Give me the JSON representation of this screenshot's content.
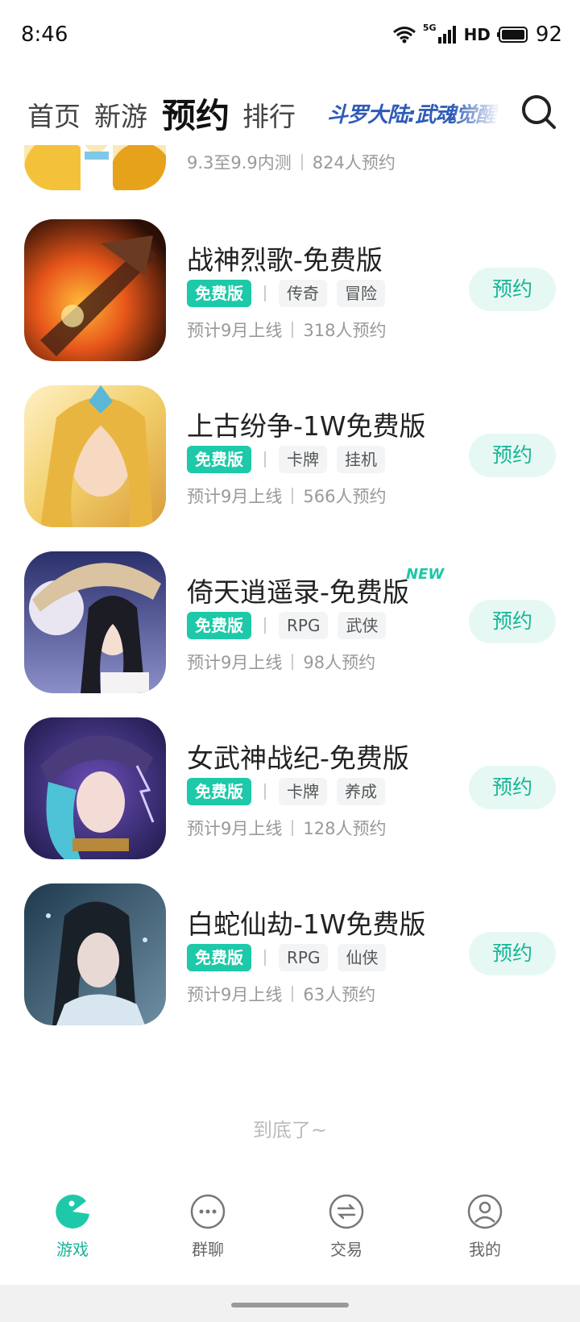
{
  "status_bar": {
    "time": "8:46",
    "network": "5G",
    "hd": "HD",
    "battery": "92"
  },
  "top_nav": {
    "tabs": [
      "首页",
      "新游",
      "预约",
      "排行"
    ],
    "active_tab": "预约",
    "promo_banner": "斗罗大陆:武魂觉醒",
    "search_icon": "search-icon"
  },
  "games": [
    {
      "title": "",
      "free_tag": "",
      "tags": [],
      "schedule": "9.3至9.9内测",
      "reservations": "824人预约",
      "button": "",
      "new": false,
      "palette": [
        "#f4c23a",
        "#fff3d8",
        "#e6a21b"
      ]
    },
    {
      "title": "战神烈歌-免费版",
      "free_tag": "免费版",
      "tags": [
        "传奇",
        "冒险"
      ],
      "schedule": "预计9月上线",
      "reservations": "318人预约",
      "button": "预约",
      "new": false,
      "palette": [
        "#2a0f06",
        "#e8561a",
        "#ffbb3a"
      ]
    },
    {
      "title": "上古纷争-1W免费版",
      "free_tag": "免费版",
      "tags": [
        "卡牌",
        "挂机"
      ],
      "schedule": "预计9月上线",
      "reservations": "566人预约",
      "button": "预约",
      "new": false,
      "palette": [
        "#f2cf6a",
        "#fff0c6",
        "#d99c3b"
      ]
    },
    {
      "title": "倚天逍遥录-免费版",
      "free_tag": "免费版",
      "tags": [
        "RPG",
        "武侠"
      ],
      "schedule": "预计9月上线",
      "reservations": "98人预约",
      "button": "预约",
      "new": true,
      "new_label": "NEW",
      "palette": [
        "#2b2f6b",
        "#e9e6f2",
        "#b99a6b"
      ]
    },
    {
      "title": "女武神战纪-免费版",
      "free_tag": "免费版",
      "tags": [
        "卡牌",
        "养成"
      ],
      "schedule": "预计9月上线",
      "reservations": "128人预约",
      "button": "预约",
      "new": false,
      "palette": [
        "#1e1a4a",
        "#4ec2d6",
        "#8e5cc9"
      ]
    },
    {
      "title": "白蛇仙劫-1W免费版",
      "free_tag": "免费版",
      "tags": [
        "RPG",
        "仙侠"
      ],
      "schedule": "预计9月上线",
      "reservations": "63人预约",
      "button": "预约",
      "new": false,
      "palette": [
        "#1f3a4e",
        "#d7e6ef",
        "#6e8ea3"
      ]
    }
  ],
  "end_text": "到底了~",
  "bottom_nav": [
    {
      "label": "游戏",
      "icon": "game-icon",
      "active": true
    },
    {
      "label": "群聊",
      "icon": "chat-icon",
      "active": false
    },
    {
      "label": "交易",
      "icon": "trade-icon",
      "active": false
    },
    {
      "label": "我的",
      "icon": "profile-icon",
      "active": false
    }
  ],
  "colors": {
    "accent": "#1dc9a8",
    "accent_text": "#17b597",
    "button_bg": "#e6f8f4"
  }
}
